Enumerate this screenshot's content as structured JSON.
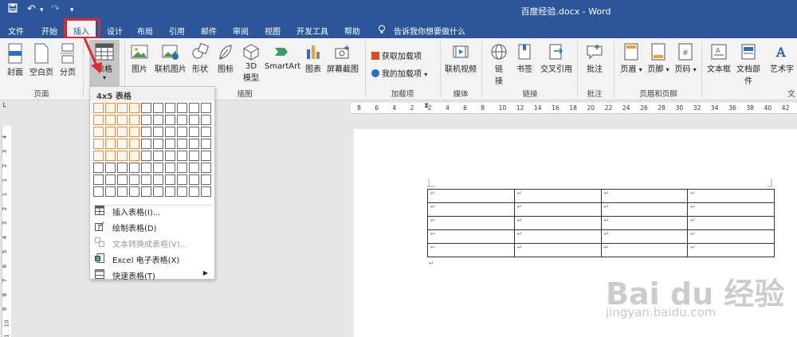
{
  "titlebar": {
    "title": "百度经验.docx - Word"
  },
  "tabs": [
    {
      "label": "文件"
    },
    {
      "label": "开始"
    },
    {
      "label": "插入"
    },
    {
      "label": "设计"
    },
    {
      "label": "布局"
    },
    {
      "label": "引用"
    },
    {
      "label": "邮件"
    },
    {
      "label": "审阅"
    },
    {
      "label": "视图"
    },
    {
      "label": "开发工具"
    },
    {
      "label": "帮助"
    },
    {
      "label": "告诉我你想要做什么"
    }
  ],
  "ribbon": {
    "pages": {
      "cover": "封面",
      "blank": "空白页",
      "break": "分页",
      "label": "页面"
    },
    "table": {
      "label": "表格",
      "group": "表格"
    },
    "illustrations": {
      "picture": "图片",
      "online_picture": "联机图片",
      "shapes": "形状",
      "icons": "图标",
      "model3d_line1": "3D",
      "model3d_line2": "模型",
      "smartart": "SmartArt",
      "chart": "图表",
      "screenshot": "屏幕截图",
      "label": "插图"
    },
    "addins": {
      "get": "获取加载项",
      "mine": "我的加载项",
      "label": "加载项"
    },
    "media": {
      "video": "联机视频",
      "label": "媒体"
    },
    "links": {
      "link_line1": "链",
      "link_line2": "接",
      "bookmark": "书签",
      "crossref": "交叉引用",
      "label": "链接"
    },
    "comments": {
      "comment": "批注",
      "label": "批注"
    },
    "header_footer": {
      "header": "页眉",
      "footer": "页脚",
      "page_number": "页码",
      "label": "页眉和页脚"
    },
    "text": {
      "textbox": "文本框",
      "parts": "文档部件",
      "wordart": "艺术字",
      "label": "文"
    }
  },
  "dropdown": {
    "header": "4x5 表格",
    "grid_columns": 10,
    "grid_rows": 8,
    "selected_columns": 4,
    "selected_rows": 5,
    "items": [
      {
        "label": "插入表格(I)...",
        "disabled": false
      },
      {
        "label": "绘制表格(D)",
        "disabled": false
      },
      {
        "label": "文本转换成表格(V)...",
        "disabled": true
      },
      {
        "label": "Excel 电子表格(X)",
        "disabled": false
      },
      {
        "label": "快速表格(T)",
        "disabled": false
      }
    ]
  },
  "ruler": {
    "ticks": [
      "8",
      "6",
      "4",
      "2",
      "2",
      "4",
      "6",
      "8",
      "10",
      "12",
      "14",
      "16",
      "18",
      "20",
      "22",
      "24",
      "26",
      "28",
      "30",
      "32",
      "34",
      "36",
      "38",
      "40",
      "42"
    ],
    "left_ticks": [
      "4",
      "3",
      "2",
      "1",
      "1",
      "2",
      "3",
      "4",
      "5",
      "6",
      "7",
      "8",
      "9",
      "10",
      "11"
    ]
  },
  "document": {
    "table_rows": 5,
    "table_cols": 4,
    "cell_mark": "↵",
    "para_mark": "↵"
  },
  "watermark": {
    "main": "Bai du 经验",
    "sub": "jingyan.baidu.com"
  },
  "colors": {
    "word_blue": "#2b579a",
    "highlight_red": "#e0282e",
    "grid_orange": "#f08b3a"
  }
}
